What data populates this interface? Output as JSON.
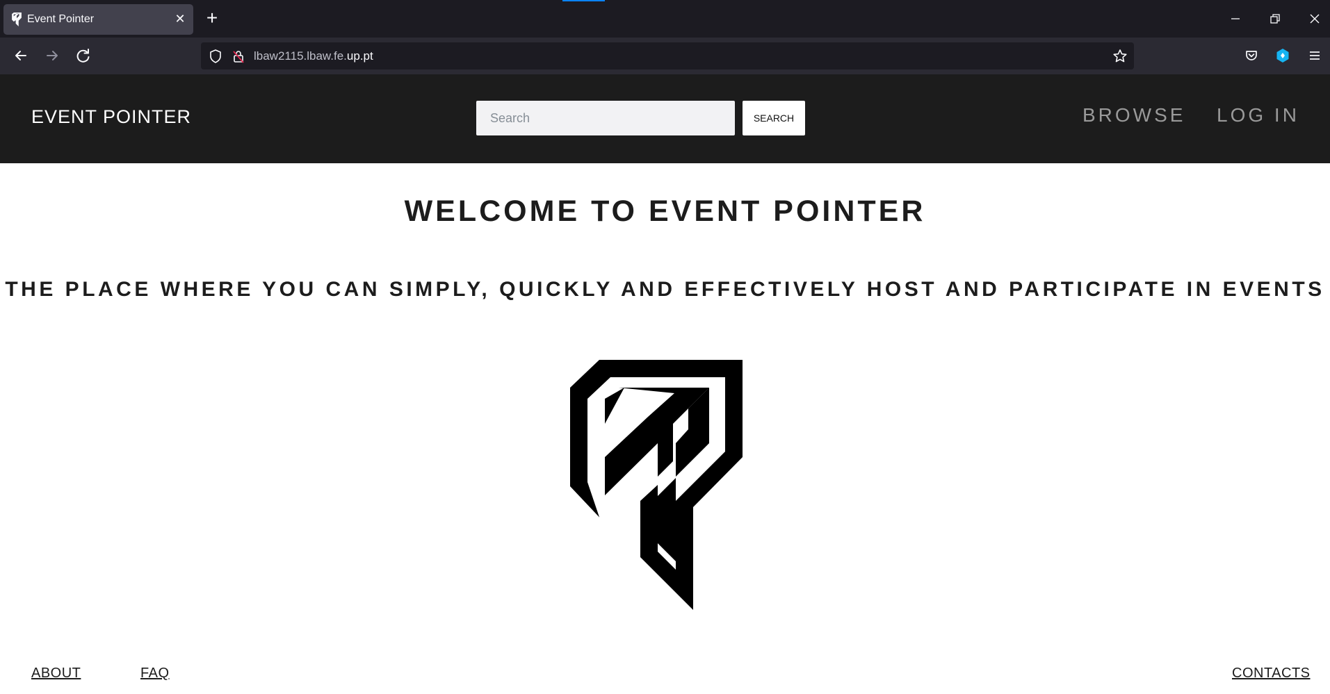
{
  "browser": {
    "tab_title": "Event Pointer",
    "url_prefix": "lbaw2115.lbaw.fe.",
    "url_domain": "up.pt"
  },
  "header": {
    "brand": "EVENT POINTER",
    "search_placeholder": "Search",
    "search_button": "SEARCH",
    "nav": [
      "BROWSE",
      "LOG IN"
    ]
  },
  "main": {
    "welcome": "WELCOME TO EVENT POINTER",
    "tagline": "THE PLACE WHERE YOU CAN SIMPLY, QUICKLY AND EFFECTIVELY HOST AND PARTICIPATE IN EVENTS"
  },
  "footer": {
    "about": "ABOUT",
    "faq": "FAQ",
    "contacts": "CONTACTS"
  },
  "colors": {
    "header_bg": "#1c1c1c",
    "browser_tabbar": "#1c1b22",
    "browser_navbar": "#2b2a33",
    "accent": "#0a84ff"
  }
}
